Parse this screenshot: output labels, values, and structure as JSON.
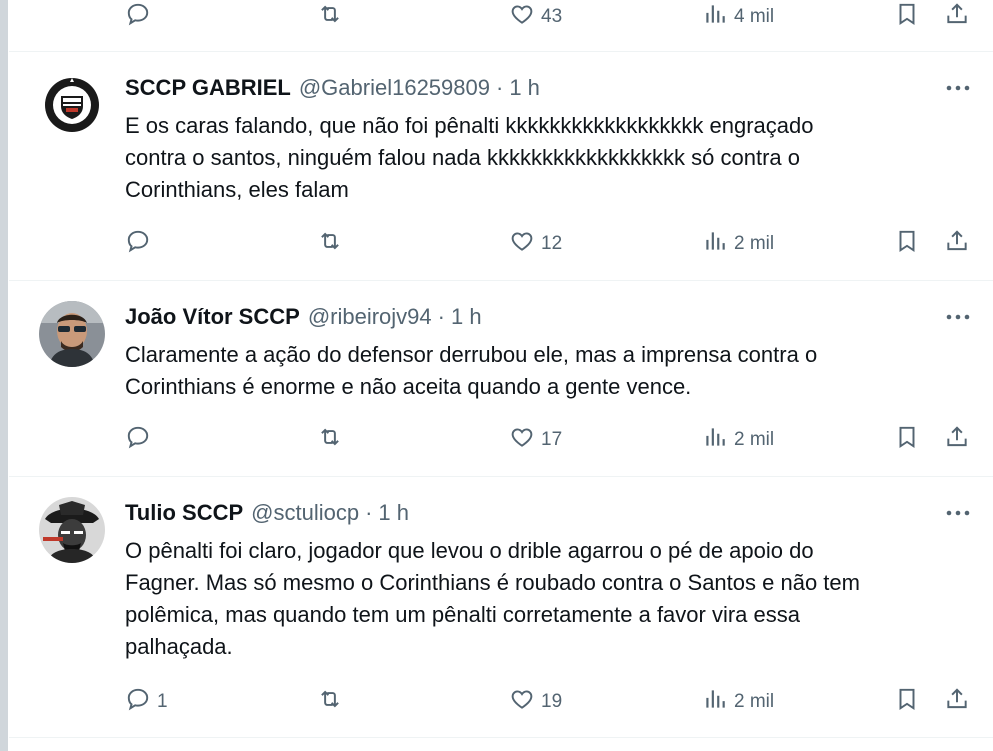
{
  "top_actions": {
    "reply_count": "",
    "retweet_count": "",
    "like_count": "43",
    "views_count": "4 mil"
  },
  "tweets": [
    {
      "name": "SCCP GABRIEL",
      "handle": "@Gabriel16259809",
      "dot": "·",
      "time": "1 h",
      "lines": [
        "E os caras falando, que não foi pênalti kkkkkkkkkkkkkkkkkk engraçado",
        "contra o santos, ninguém falou nada kkkkkkkkkkkkkkkkkk só contra o",
        "Corinthians, eles falam"
      ],
      "reply_count": "",
      "retweet_count": "",
      "like_count": "12",
      "views_count": "2 mil"
    },
    {
      "name": "João Vítor SCCP",
      "handle": "@ribeirojv94",
      "dot": "·",
      "time": "1 h",
      "lines": [
        "Claramente a ação do defensor derrubou ele, mas a imprensa contra o",
        "Corinthians é enorme e não aceita quando a gente vence."
      ],
      "reply_count": "",
      "retweet_count": "",
      "like_count": "17",
      "views_count": "2 mil"
    },
    {
      "name": "Tulio SCCP",
      "handle": "@sctuliocp",
      "dot": "·",
      "time": "1 h",
      "lines": [
        "O pênalti foi claro, jogador que levou o drible agarrou o pé de apoio do",
        "Fagner. Mas só mesmo o Corinthians é roubado contra o Santos e não tem",
        "polêmica, mas quando tem um pênalti corretamente a favor vira essa",
        "palhaçada."
      ],
      "reply_count": "1",
      "retweet_count": "",
      "like_count": "19",
      "views_count": "2 mil"
    }
  ],
  "colors": {
    "text_primary": "#0f1419",
    "text_secondary": "#536471",
    "separator": "#eff3f4"
  }
}
